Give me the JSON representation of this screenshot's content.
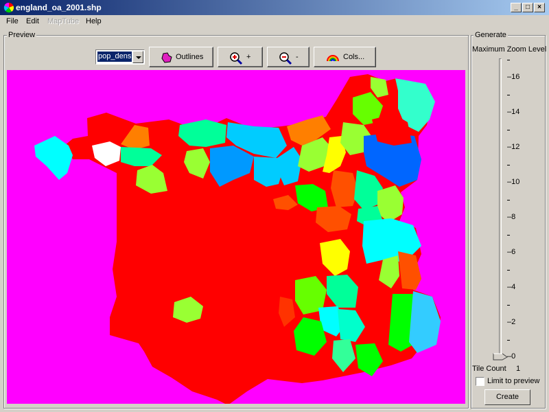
{
  "window": {
    "title": "england_oa_2001.shp"
  },
  "menu": {
    "file": "File",
    "edit": "Edit",
    "maptube": "MapTube",
    "help": "Help"
  },
  "preview": {
    "group_label": "Preview",
    "variable_select": {
      "selected": "pop_dens"
    },
    "buttons": {
      "outlines": "Outlines",
      "zoom_in": "+",
      "zoom_out": "-",
      "colours": "Cols..."
    },
    "map": {
      "background_color": "#ff00ff",
      "base_region_color": "#ff0000"
    }
  },
  "generate": {
    "group_label": "Generate",
    "zoom_label": "Maximum Zoom Level",
    "zoom_value": 0,
    "zoom_range": [
      0,
      17
    ],
    "tick_labels": [
      "16",
      "14",
      "12",
      "10",
      "8",
      "6",
      "4",
      "2",
      "0"
    ],
    "tile_count_label": "Tile Count",
    "tile_count_value": "1",
    "limit_label": "Limit to preview",
    "limit_checked": false,
    "create_label": "Create"
  },
  "icons": {
    "app": "colour-wheel-icon",
    "outlines": "polygon-outline-icon",
    "zoom_in": "magnifier-plus-icon",
    "zoom_out": "magnifier-minus-icon",
    "colours": "rainbow-icon"
  }
}
